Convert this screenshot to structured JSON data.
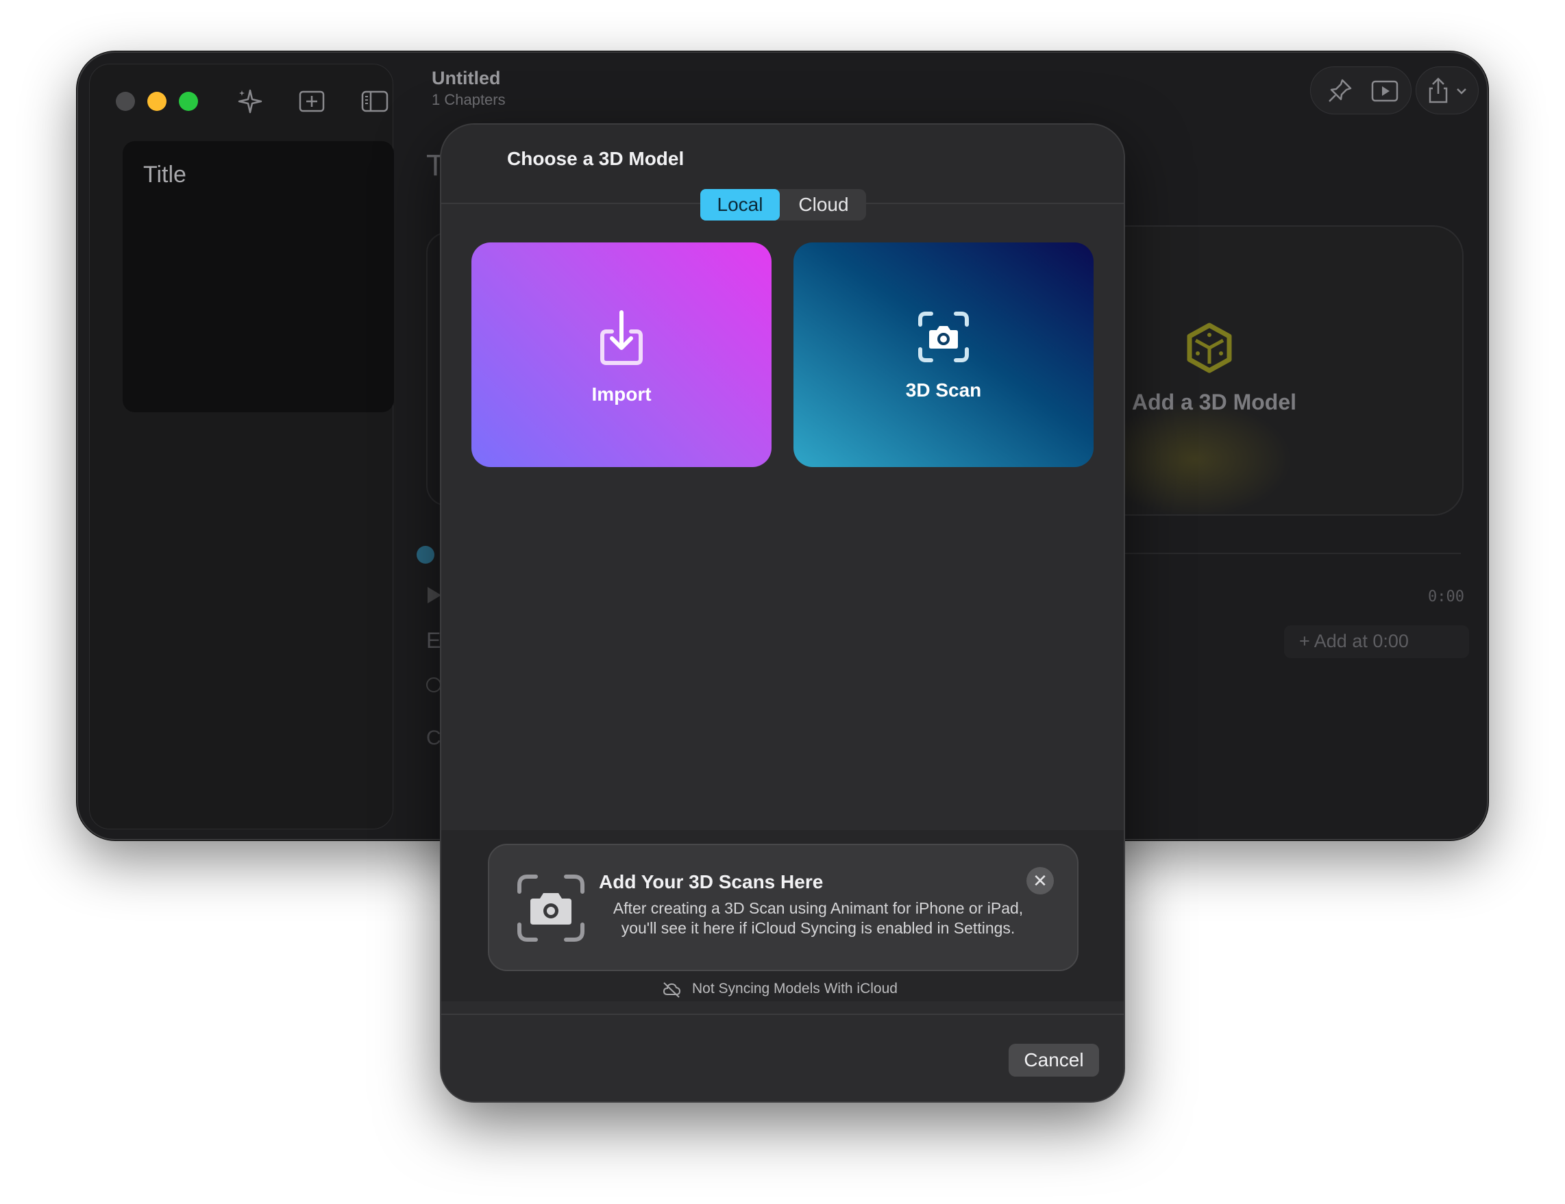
{
  "app": {
    "document_title": "Untitled",
    "document_subtitle": "1 Chapters",
    "sidebar": {
      "title_card_label": "Title"
    },
    "canvas": {
      "partial_heading": "T",
      "add_model_label": "Add a 3D Model",
      "timecode": "0:00",
      "add_at_button_label": "+ Add at 0:00",
      "partial_label_e": "E",
      "partial_label_c": "C"
    },
    "icons": {
      "toolbar": [
        "sparkles-icon",
        "add-square-icon",
        "sidebar-toggle-icon"
      ],
      "right_toolbar": [
        "pin-icon",
        "play-preview-icon",
        "share-icon",
        "chevron-down-icon"
      ]
    }
  },
  "dialog": {
    "title": "Choose a 3D Model",
    "tabs": [
      {
        "label": "Local",
        "selected": true
      },
      {
        "label": "Cloud",
        "selected": false
      }
    ],
    "tiles": {
      "import_label": "Import",
      "scan_label": "3D Scan"
    },
    "scan_hint": {
      "title": "Add Your 3D Scans Here",
      "body": "After creating a 3D Scan using Animant for iPhone or iPad, you'll see it here if iCloud Syncing is enabled in Settings.",
      "close_glyph": "✕"
    },
    "sync_status": "Not Syncing Models With iCloud",
    "cancel_label": "Cancel"
  },
  "colors": {
    "accent_selected_tab": "#3ec4f5",
    "traffic_min": "#febc2e",
    "traffic_max": "#28c840"
  }
}
